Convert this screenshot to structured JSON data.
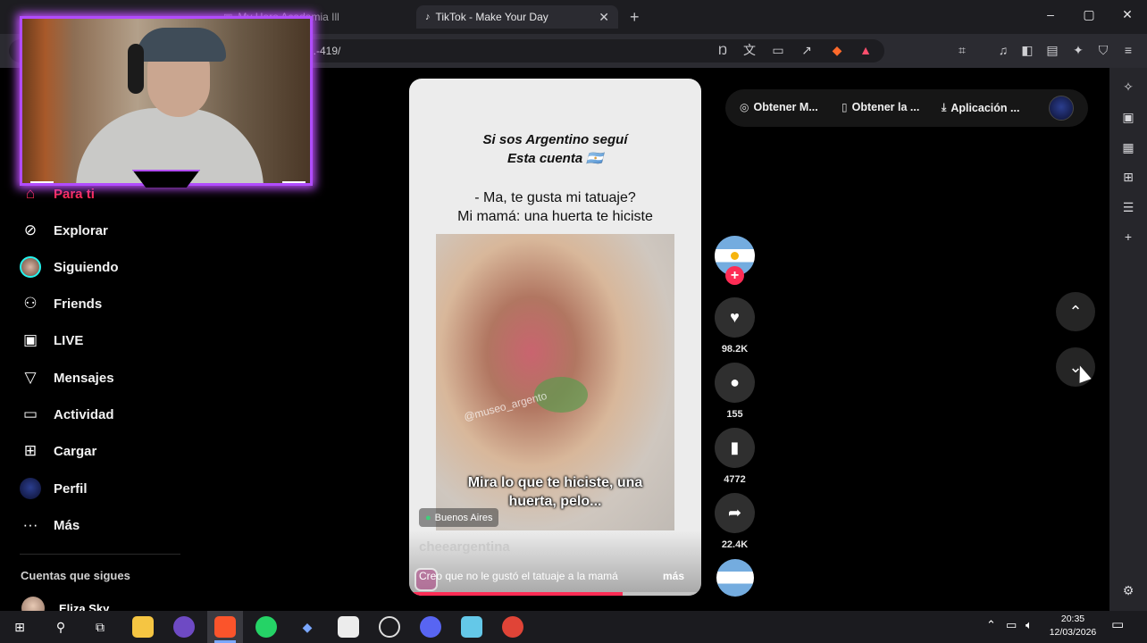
{
  "browser": {
    "tabs": [
      {
        "label": "My Hero Academia Ill",
        "active": false
      },
      {
        "label": "TikTok - Make Your Day",
        "active": true
      }
    ],
    "url_suffix": "...-419/",
    "window_controls": {
      "minimize": "–",
      "maximize": "▢",
      "close": "✕"
    },
    "new_tab": "+"
  },
  "webcam": {
    "frame_color": "#b14cff"
  },
  "nav": {
    "items": [
      {
        "label": "Para ti",
        "icon": "home-icon",
        "active": true
      },
      {
        "label": "Explorar",
        "icon": "compass-icon",
        "active": false
      },
      {
        "label": "Siguiendo",
        "icon": "following-avatar-icon",
        "active": false
      },
      {
        "label": "Friends",
        "icon": "friends-icon",
        "active": false
      },
      {
        "label": "LIVE",
        "icon": "live-icon",
        "active": false
      },
      {
        "label": "Mensajes",
        "icon": "send-icon",
        "active": false
      },
      {
        "label": "Actividad",
        "icon": "activity-icon",
        "active": false
      },
      {
        "label": "Cargar",
        "icon": "upload-icon",
        "active": false
      },
      {
        "label": "Perfil",
        "icon": "profile-avatar-icon",
        "active": false
      },
      {
        "label": "Más",
        "icon": "more-icon",
        "active": false
      }
    ],
    "following_heading": "Cuentas que sigues",
    "following_users": [
      "Eliza Sky"
    ]
  },
  "top_actions": {
    "chip1": "Obtener M...",
    "chip2": "Obtener la ...",
    "chip3": "Aplicación ..."
  },
  "video": {
    "title_line1": "Si sos Argentino seguí",
    "title_line2": "Esta cuenta 🇦🇷",
    "text_line1": "- Ma, te gusta mi tatuaje?",
    "text_line2": "Mi mamá: una huerta te hiciste",
    "watermark": "@museo_argento",
    "caption_line1": "Mira lo que te hiciste, una",
    "caption_line2": "huerta, pelo...",
    "location": "Buenos Aires",
    "author": "cheeargentina",
    "description": "Creo que no le gustó el tatuaje a la mamá",
    "more": "más",
    "progress": 0.73,
    "accent": "#fe2c55"
  },
  "actions": {
    "likes": "98.2K",
    "comments": "155",
    "saves": "4772",
    "shares": "22.4K"
  },
  "taskbar": {
    "time": "20:35",
    "date": "12/03/2026"
  }
}
